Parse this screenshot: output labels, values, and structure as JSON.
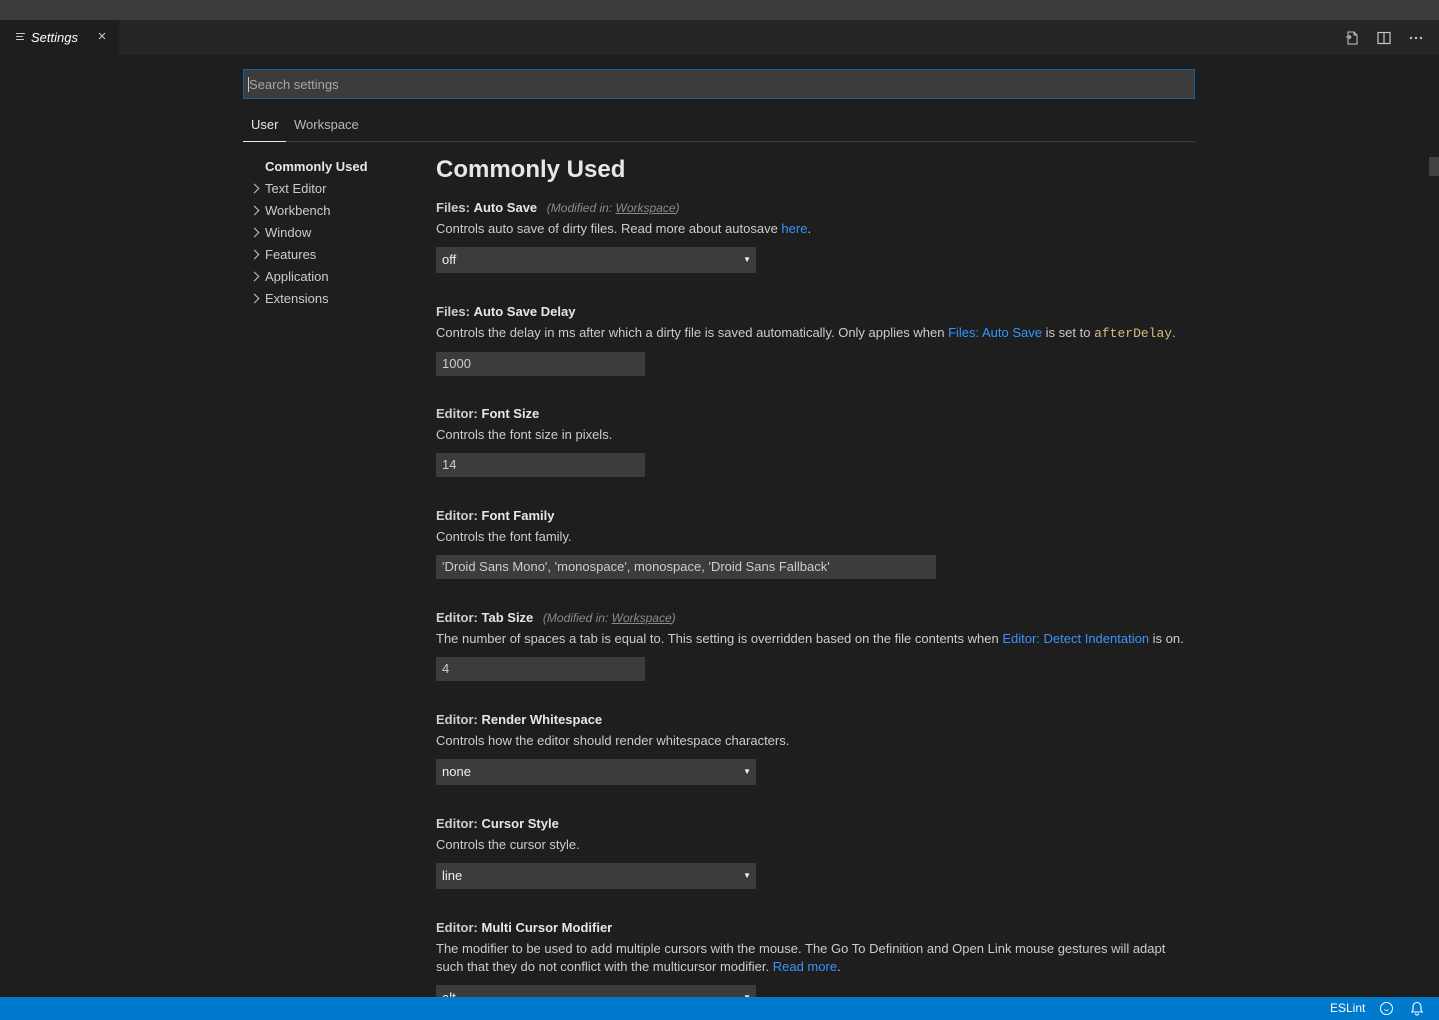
{
  "tab": {
    "title": "Settings",
    "close_glyph": "×"
  },
  "tab_actions": [
    {
      "name": "open-settings-json-icon",
      "glyph": "⎘"
    },
    {
      "name": "split-editor-icon",
      "glyph": "◫"
    },
    {
      "name": "more-actions-icon",
      "glyph": "···"
    }
  ],
  "search": {
    "placeholder": "Search settings",
    "value": ""
  },
  "scopes": {
    "user": "User",
    "workspace": "Workspace"
  },
  "toc": [
    {
      "label": "Commonly Used",
      "expandable": false
    },
    {
      "label": "Text Editor",
      "expandable": true
    },
    {
      "label": "Workbench",
      "expandable": true
    },
    {
      "label": "Window",
      "expandable": true
    },
    {
      "label": "Features",
      "expandable": true
    },
    {
      "label": "Application",
      "expandable": true
    },
    {
      "label": "Extensions",
      "expandable": true
    }
  ],
  "group_title": "Commonly Used",
  "settings": {
    "auto_save": {
      "category": "Files:",
      "name": "Auto Save",
      "modified_prefix": "(Modified in:",
      "modified_scope": "Workspace",
      "modified_suffix": ")",
      "desc": "Controls auto save of dirty files. Read more about autosave",
      "desc_link": "here",
      "desc_end": ".",
      "value": "off"
    },
    "auto_save_delay": {
      "category": "Files:",
      "name": "Auto Save Delay",
      "desc": "Controls the delay in ms after which a dirty file is saved automatically. Only applies when",
      "desc_link": "Files: Auto Save",
      "desc_mid": "is set to",
      "desc_code": "afterDelay",
      "desc_end": ".",
      "value": "1000"
    },
    "font_size": {
      "category": "Editor:",
      "name": "Font Size",
      "desc": "Controls the font size in pixels.",
      "value": "14"
    },
    "font_family": {
      "category": "Editor:",
      "name": "Font Family",
      "desc": "Controls the font family.",
      "value": "'Droid Sans Mono', 'monospace', monospace, 'Droid Sans Fallback'"
    },
    "tab_size": {
      "category": "Editor:",
      "name": "Tab Size",
      "modified_prefix": "(Modified in:",
      "modified_scope": "Workspace",
      "modified_suffix": ")",
      "desc": "The number of spaces a tab is equal to. This setting is overridden based on the file contents when",
      "desc_link": "Editor: Detect Indentation",
      "desc_end": "is on.",
      "value": "4"
    },
    "render_whitespace": {
      "category": "Editor:",
      "name": "Render Whitespace",
      "desc": "Controls how the editor should render whitespace characters.",
      "value": "none"
    },
    "cursor_style": {
      "category": "Editor:",
      "name": "Cursor Style",
      "desc": "Controls the cursor style.",
      "value": "line"
    },
    "multi_cursor_modifier": {
      "category": "Editor:",
      "name": "Multi Cursor Modifier",
      "desc": "The modifier to be used to add multiple cursors with the mouse. The Go To Definition and Open Link mouse gestures will adapt such that they do not conflict with the multicursor modifier.",
      "desc_link": "Read more",
      "desc_end": ".",
      "value": "alt"
    }
  },
  "dropdown_arrow": "▼",
  "statusbar": {
    "eslint": "ESLint"
  },
  "colors": {
    "accent": "#007acc",
    "link": "#3794ff",
    "code": "#d7ba7d",
    "focus_border": "#0e639c"
  }
}
